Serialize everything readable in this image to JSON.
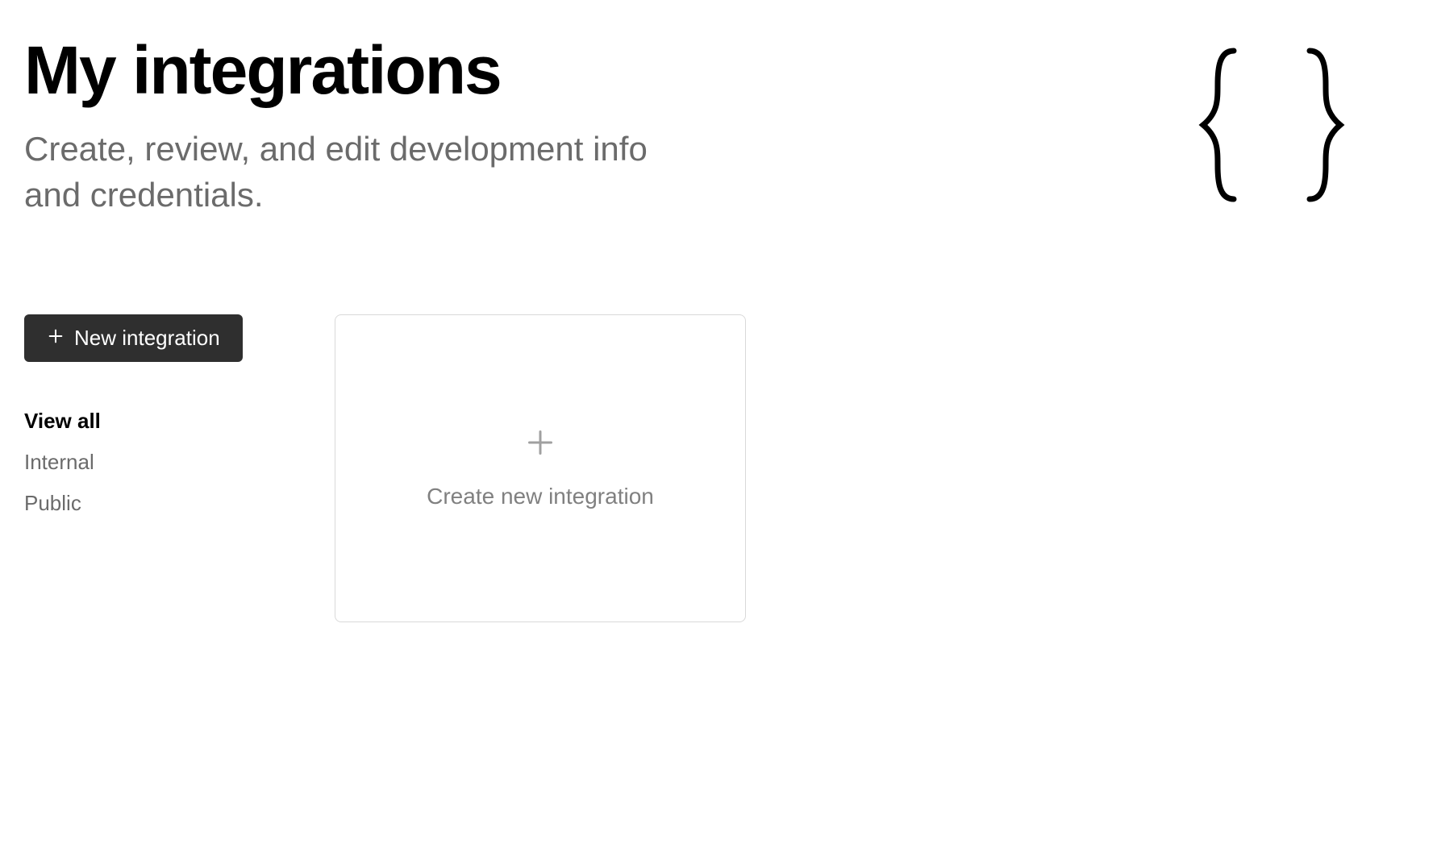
{
  "header": {
    "title": "My integrations",
    "subtitle": "Create, review, and edit development info and credentials."
  },
  "sidebar": {
    "newIntegrationButton": "New integration",
    "filters": [
      {
        "label": "View all",
        "active": true
      },
      {
        "label": "Internal",
        "active": false
      },
      {
        "label": "Public",
        "active": false
      }
    ]
  },
  "main": {
    "createCardLabel": "Create new integration"
  }
}
